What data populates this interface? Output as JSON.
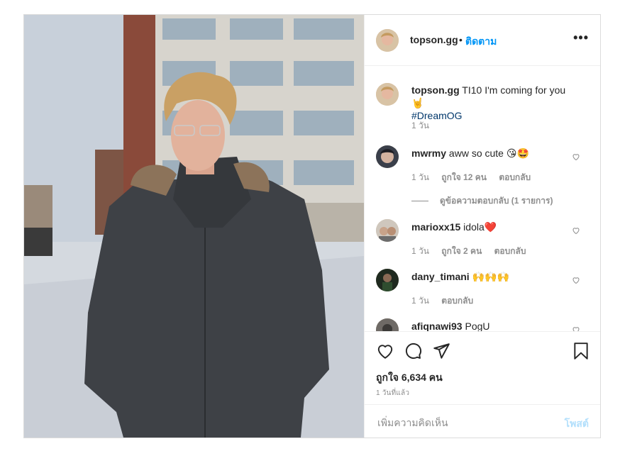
{
  "header": {
    "username": "topson.gg",
    "separator": "•",
    "follow_label": "ติดตาม",
    "more_icon": "more-horizontal-icon",
    "more_label": "•••"
  },
  "caption": {
    "username": "topson.gg",
    "text": "TI10 I'm coming for you 🤘",
    "hashtag": "#DreamOG",
    "time": "1 วัน"
  },
  "comments": [
    {
      "username": "mwrmy",
      "text": "aww so cute 😘🤩",
      "time": "1 วัน",
      "likes": "ถูกใจ 12 คน",
      "reply": "ตอบกลับ",
      "view_replies": "ดูข้อความตอบกลับ (1 รายการ)"
    },
    {
      "username": "marioxx15",
      "text": "idola❤️",
      "time": "1 วัน",
      "likes": "ถูกใจ 2 คน",
      "reply": "ตอบกลับ"
    },
    {
      "username": "dany_timani",
      "text": "🙌🙌🙌",
      "time": "1 วัน",
      "reply": "ตอบกลับ"
    },
    {
      "username": "afiqnawi93",
      "text": "PogU"
    }
  ],
  "actions": {
    "like_icon": "heart-icon",
    "comment_icon": "comment-icon",
    "share_icon": "share-icon",
    "save_icon": "bookmark-icon",
    "likes_text": "ถูกใจ 6,634 คน",
    "posted_time": "1 วันที่แล้ว"
  },
  "add_comment": {
    "placeholder": "เพิ่มความคิดเห็น",
    "post_label": "โพสต์"
  },
  "colors": {
    "link_blue": "#0095f6",
    "post_disabled": "#b2dffc",
    "muted_text": "#8e8e8e",
    "hashtag": "#00376b"
  }
}
